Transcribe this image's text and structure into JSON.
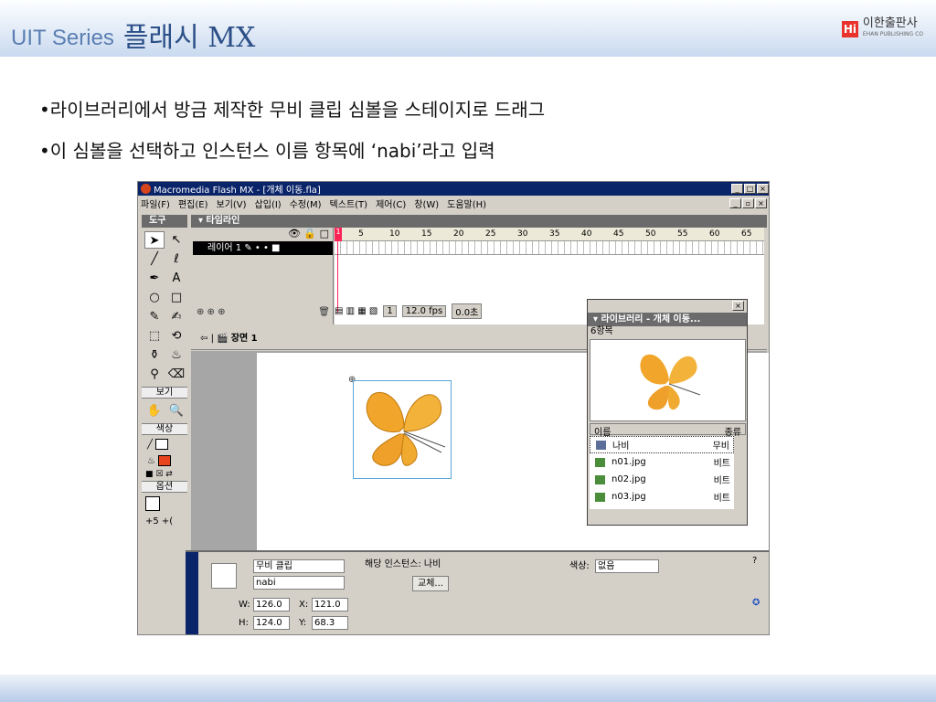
{
  "header": {
    "series": "UIT Series",
    "subject": "플래시 MX",
    "publisher_mark": "Hi",
    "publisher": "이한출판사",
    "publisher_en": "EHAN PUBLISHING CO"
  },
  "bullets": [
    "•라이브러리에서 방금 제작한 무비 클립 심볼을 스테이지로 드래그",
    "•이 심볼을 선택하고 인스턴스 이름 항목에 ‘nabi’라고 입력"
  ],
  "window": {
    "title": "Macromedia Flash MX - [개체 이동.fla]"
  },
  "menu": [
    "파일(F)",
    "편집(E)",
    "보기(V)",
    "삽입(I)",
    "수정(M)",
    "텍스트(T)",
    "제어(C)",
    "창(W)",
    "도움말(H)"
  ],
  "tools": {
    "title": "도구",
    "view_label": "보기",
    "color_label": "색상",
    "options_label": "옵션"
  },
  "timeline": {
    "title": "▾ 타임라인",
    "layer_name": "레이어 1",
    "ticks": [
      "1",
      "5",
      "10",
      "15",
      "20",
      "25",
      "30",
      "35",
      "40",
      "45",
      "50",
      "55",
      "60",
      "65"
    ],
    "frame": "1",
    "fps": "12.0 fps",
    "time": "0.0초"
  },
  "scene": {
    "label": "장면 1"
  },
  "library": {
    "title": "▾ 라이브러리 - 개체 이동...",
    "count": "6항목",
    "col_name": "이름",
    "col_kind": "종류",
    "items": [
      {
        "name": "나비",
        "kind": "무비"
      },
      {
        "name": "n01.jpg",
        "kind": "비트"
      },
      {
        "name": "n02.jpg",
        "kind": "비트"
      },
      {
        "name": "n03.jpg",
        "kind": "비트"
      }
    ]
  },
  "properties": {
    "behavior": "무비 클립",
    "instance_name": "nabi",
    "instance_of": "해당 인스턴스: 나비",
    "swap": "교체...",
    "color_label": "색상:",
    "color_value": "없음",
    "w_label": "W:",
    "w": "126.0",
    "x_label": "X:",
    "x": "121.0",
    "h_label": "H:",
    "h": "124.0",
    "y_label": "Y:",
    "y": "68.3"
  }
}
